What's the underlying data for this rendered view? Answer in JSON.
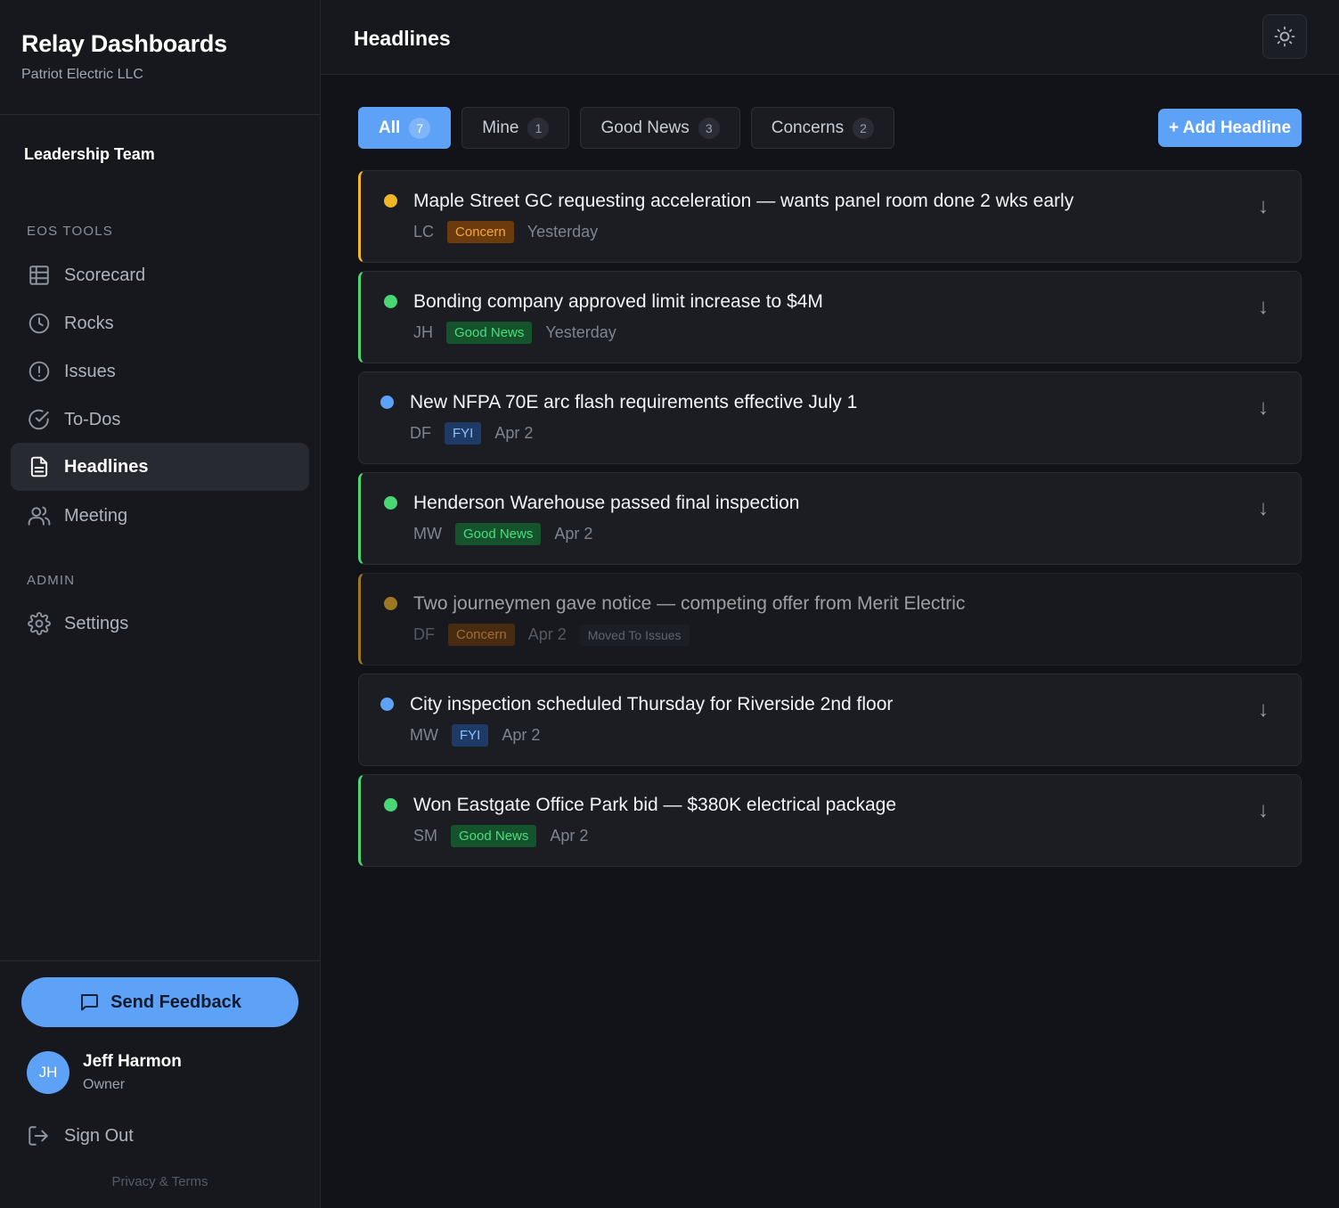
{
  "brand": {
    "title": "Relay Dashboards",
    "company": "Patriot Electric LLC"
  },
  "team": "Leadership Team",
  "nav": {
    "section_tools": "EOS TOOLS",
    "section_admin": "ADMIN",
    "items": [
      {
        "label": "Scorecard",
        "icon": "table-icon"
      },
      {
        "label": "Rocks",
        "icon": "clock-icon"
      },
      {
        "label": "Issues",
        "icon": "alert-circle-icon"
      },
      {
        "label": "To-Dos",
        "icon": "check-circle-icon"
      },
      {
        "label": "Headlines",
        "icon": "document-icon",
        "active": true
      },
      {
        "label": "Meeting",
        "icon": "users-icon"
      },
      {
        "label": "Settings",
        "icon": "gear-icon"
      }
    ]
  },
  "feedback_label": "Send Feedback",
  "user": {
    "initials": "JH",
    "name": "Jeff Harmon",
    "role": "Owner"
  },
  "signout_label": "Sign Out",
  "privacy_label": "Privacy & Terms",
  "header": {
    "title": "Headlines"
  },
  "filters": [
    {
      "label": "All",
      "count": "7",
      "active": true
    },
    {
      "label": "Mine",
      "count": "1"
    },
    {
      "label": "Good News",
      "count": "3"
    },
    {
      "label": "Concerns",
      "count": "2"
    }
  ],
  "add_label": "+ Add Headline",
  "colors": {
    "accent": "#5ea2f7",
    "concern": "#f0b628",
    "good": "#4ad675",
    "fyi": "#5ea2f7"
  },
  "headlines": [
    {
      "title": "Maple Street GC requesting acceleration — wants panel room done 2 wks early",
      "author": "LC",
      "tag": "Concern",
      "date": "Yesterday"
    },
    {
      "title": "Bonding company approved limit increase to $4M",
      "author": "JH",
      "tag": "Good News",
      "date": "Yesterday"
    },
    {
      "title": "New NFPA 70E arc flash requirements effective July 1",
      "author": "DF",
      "tag": "FYI",
      "date": "Apr 2"
    },
    {
      "title": "Henderson Warehouse passed final inspection",
      "author": "MW",
      "tag": "Good News",
      "date": "Apr 2"
    },
    {
      "title": "Two journeymen gave notice — competing offer from Merit Electric",
      "author": "DF",
      "tag": "Concern",
      "date": "Apr 2",
      "status": "Moved To Issues"
    },
    {
      "title": "City inspection scheduled Thursday for Riverside 2nd floor",
      "author": "MW",
      "tag": "FYI",
      "date": "Apr 2"
    },
    {
      "title": "Won Eastgate Office Park bid — $380K electrical package",
      "author": "SM",
      "tag": "Good News",
      "date": "Apr 2"
    }
  ],
  "move_icon": "arrow-down-icon"
}
